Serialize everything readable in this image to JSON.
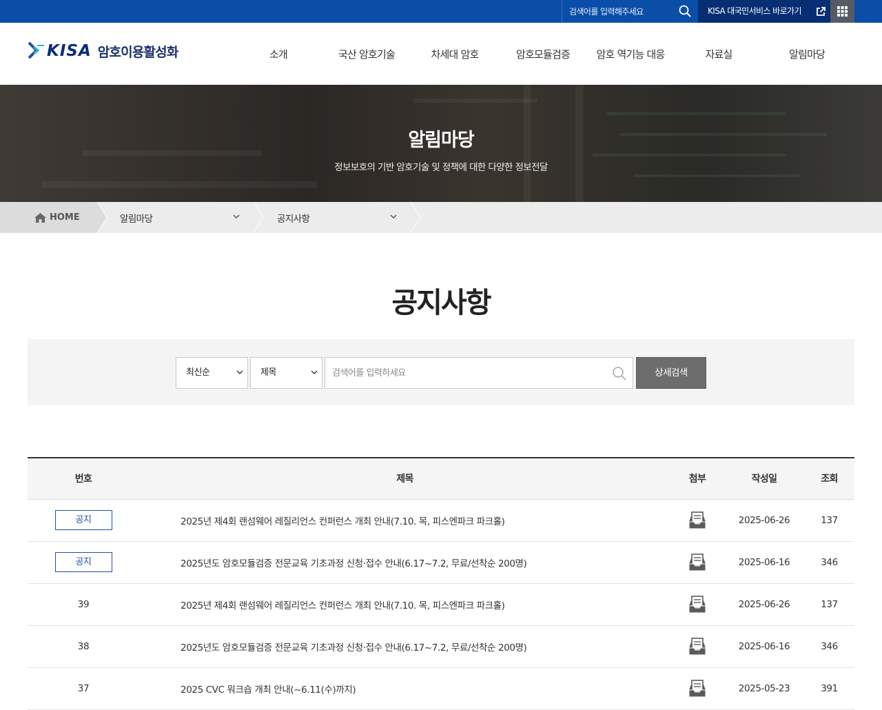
{
  "topbar": {
    "search_placeholder": "검색어를 입력해주세요",
    "service_link": "KISA 대국민서비스 바로가기",
    "colors": {
      "bar": "#0a4ea8",
      "service": "#062e73",
      "grid": "#555b66"
    }
  },
  "header": {
    "logo_brand": "KISA",
    "logo_site": "암호이용활성화",
    "nav": [
      "소개",
      "국산 암호기술",
      "차세대 암호",
      "암호모듈검증",
      "암호 역기능 대응",
      "자료실",
      "알림마당"
    ]
  },
  "hero": {
    "title": "알림마당",
    "subtitle": "정보보호의 기반 암호기술 및 정책에 대한 다양한 정보전달"
  },
  "breadcrumb": {
    "home": "HOME",
    "level1": "알림마당",
    "level2": "공지사항"
  },
  "page": {
    "title": "공지사항"
  },
  "search": {
    "sort_value": "최신순",
    "field_value": "제목",
    "placeholder": "검색어를 입력하세요",
    "advanced_button": "상세검색"
  },
  "table": {
    "headers": [
      "번호",
      "제목",
      "첨부",
      "작성일",
      "조회"
    ],
    "rows": [
      {
        "no": "공지",
        "notice": true,
        "title": "2025년 제4회 랜섬웨어 레질리언스 컨퍼런스 개최 안내(7.10. 목, 피스엔파크 파크홀)",
        "attach": "attachment-icon",
        "date": "2025-06-26",
        "views": "137"
      },
      {
        "no": "공지",
        "notice": true,
        "title": "2025년도 암호모듈검증 전문교육 기초과정 신청·접수 안내(6.17~7.2, 무료/선착순 200명)",
        "attach": "attachment-icon",
        "date": "2025-06-16",
        "views": "346"
      },
      {
        "no": "39",
        "notice": false,
        "title": "2025년 제4회 랜섬웨어 레질리언스 컨퍼런스 개최 안내(7.10. 목, 피스엔파크 파크홀)",
        "attach": "attachment-icon",
        "date": "2025-06-26",
        "views": "137"
      },
      {
        "no": "38",
        "notice": false,
        "title": "2025년도 암호모듈검증 전문교육 기초과정 신청·접수 안내(6.17~7.2, 무료/선착순 200명)",
        "attach": "attachment-icon",
        "date": "2025-06-16",
        "views": "346"
      },
      {
        "no": "37",
        "notice": false,
        "title": "2025 CVC 워크숍 개최 안내(~6.11(수)까지)",
        "attach": "attachment-icon",
        "date": "2025-05-23",
        "views": "391"
      }
    ]
  }
}
